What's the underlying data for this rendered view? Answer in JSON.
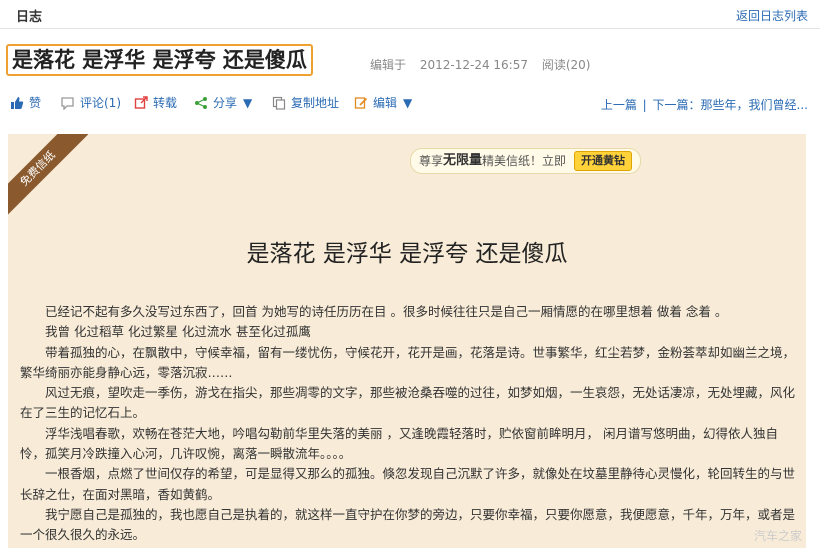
{
  "topbar": {
    "section": "日志",
    "back_link": "返回日志列表"
  },
  "post": {
    "title": "是落花 是浮华 是浮夸 还是傻瓜",
    "edited_label": "编辑于",
    "datetime": "2012-12-24 16:57",
    "views": "阅读(20)"
  },
  "actions": {
    "like": "赞",
    "comment": "评论(1)",
    "repost": "转载",
    "share": "分享",
    "copy": "复制地址",
    "edit": "编辑"
  },
  "nav": {
    "prev": "上一篇",
    "sep": "|",
    "next": "下一篇：那些年，我们曾经..."
  },
  "paper": {
    "ribbon": "免费信纸",
    "promo_prefix": "尊享",
    "promo_bold": "无限量",
    "promo_suffix": "精美信纸！立即",
    "promo_button": "开通黄钻",
    "letter_title": "是落花 是浮华 是浮夸 还是傻瓜",
    "paragraphs": [
      "已经记不起有多久没写过东西了，回首 为她写的诗任历历在目 。很多时候往往只是自己一厢情愿的在哪里想着 做着 念着 。",
      "我曾 化过稻草 化过繁星 化过流水 甚至化过孤鹰",
      "带着孤独的心，在飘散中，守候幸福，留有一缕忧伤，守候花开，花开是画，花落是诗。世事繁华，红尘若梦，金粉荟萃却如幽兰之境，繁华绮丽亦能身静心远，零落沉寂……",
      "风过无痕，望吹走一季伤，游戈在指尖，那些凋零的文字，那些被沧桑吞噬的过往，如梦如烟，一生哀怨，无处话凄凉，无处埋藏，风化在了三生的记忆石上。",
      "浮华浅唱春歌，欢畅在苍茫大地，吟唱勾勒前华里失落的美丽 ，又逢晚霞轻落时，贮依窗前眸明月， 闲月谱写悠明曲，幻得依人独自怜，孤笑月冷跌撞入心河，几许叹惋，离落一瞬散流年。。。。",
      "一根香烟，点燃了世间仅存的希望，可是显得又那么的孤独。倏忽发现自己沉默了许多，就像处在坟墓里静待心灵慢化，轮回转生的与世长辞之仕，在面对黑暗，香如黄鹤。",
      "我宁愿自己是孤独的，我也愿自己是执着的，就这样一直守护在你梦的旁边，只要你幸福，只要你愿意，我便愿意，千年，万年，或者是一个很久很久的永远。"
    ]
  },
  "watermark": "汽车之家"
}
